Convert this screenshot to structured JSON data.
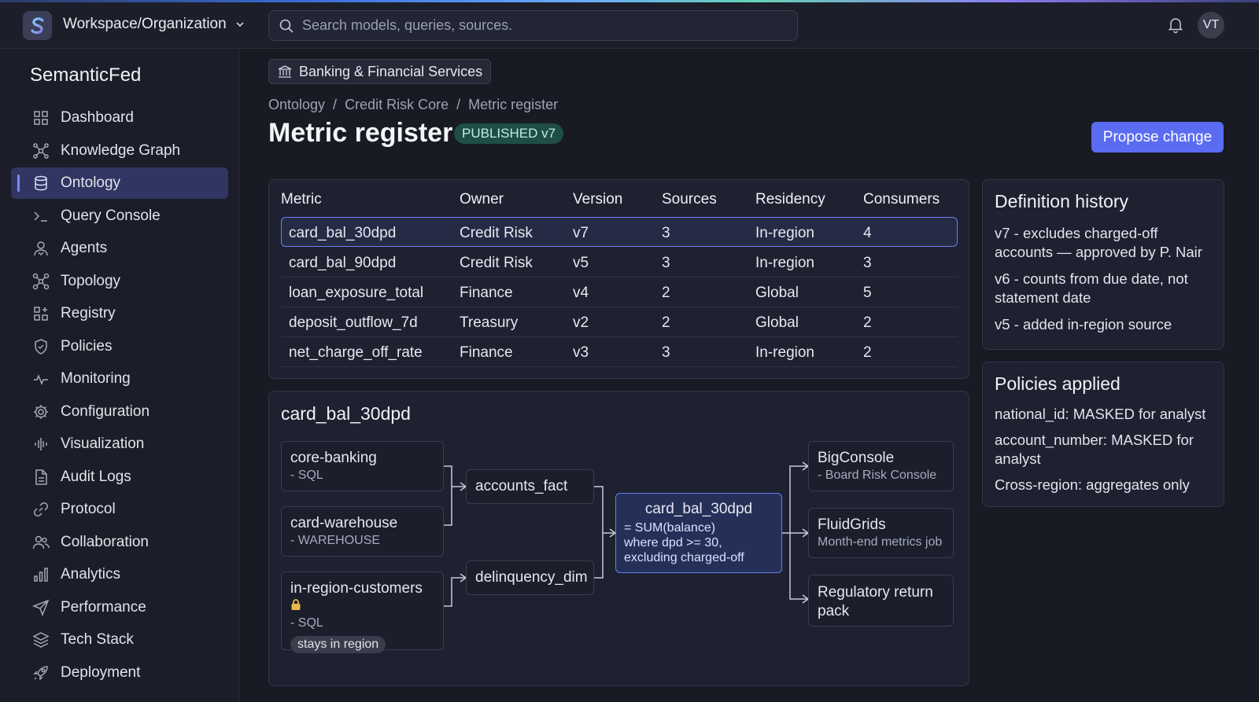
{
  "topbar": {
    "workspace_label": "Workspace/Organization",
    "search_placeholder": "Search models, queries, sources.",
    "avatar_initials": "VT"
  },
  "sidebar": {
    "brand": "SemanticFed",
    "items": [
      {
        "label": "Dashboard",
        "icon": "grid-icon"
      },
      {
        "label": "Knowledge Graph",
        "icon": "graph-icon"
      },
      {
        "label": "Ontology",
        "icon": "database-icon",
        "active": true
      },
      {
        "label": "Query Console",
        "icon": "terminal-icon"
      },
      {
        "label": "Agents",
        "icon": "agents-icon"
      },
      {
        "label": "Topology",
        "icon": "topology-icon"
      },
      {
        "label": "Registry",
        "icon": "registry-icon"
      },
      {
        "label": "Policies",
        "icon": "shield-icon"
      },
      {
        "label": "Monitoring",
        "icon": "pulse-icon"
      },
      {
        "label": "Configuration",
        "icon": "gear-icon"
      },
      {
        "label": "Visualization",
        "icon": "waveform-icon"
      },
      {
        "label": "Audit Logs",
        "icon": "document-icon"
      },
      {
        "label": "Protocol",
        "icon": "link-icon"
      },
      {
        "label": "Collaboration",
        "icon": "users-icon"
      },
      {
        "label": "Analytics",
        "icon": "bar-chart-icon"
      },
      {
        "label": "Performance",
        "icon": "send-icon"
      },
      {
        "label": "Tech Stack",
        "icon": "layers-icon"
      },
      {
        "label": "Deployment",
        "icon": "rocket-icon"
      }
    ]
  },
  "header": {
    "industry_chip": "Banking & Financial Services",
    "breadcrumb": [
      "Ontology",
      "Credit Risk Core",
      "Metric register"
    ],
    "title": "Metric register",
    "status_badge": "PUBLISHED v7",
    "propose_button": "Propose change"
  },
  "table": {
    "columns": [
      "Metric",
      "Owner",
      "Version",
      "Sources",
      "Residency",
      "Consumers"
    ],
    "rows": [
      [
        "card_bal_30dpd",
        "Credit Risk",
        "v7",
        "3",
        "In-region",
        "4"
      ],
      [
        "card_bal_90dpd",
        "Credit Risk",
        "v5",
        "3",
        "In-region",
        "3"
      ],
      [
        "loan_exposure_total",
        "Finance",
        "v4",
        "2",
        "Global",
        "5"
      ],
      [
        "deposit_outflow_7d",
        "Treasury",
        "v2",
        "2",
        "Global",
        "2"
      ],
      [
        "net_charge_off_rate",
        "Finance",
        "v3",
        "3",
        "In-region",
        "2"
      ]
    ],
    "selected_row": 0
  },
  "lineage": {
    "title": "card_bal_30dpd",
    "sources": [
      {
        "name": "core-banking",
        "sub": "- SQL"
      },
      {
        "name": "card-warehouse",
        "sub": "- WAREHOUSE"
      },
      {
        "name": "in-region-customers",
        "sub": "- SQL",
        "tag": "stays in region",
        "icon": "lock-icon"
      }
    ],
    "intermediates": [
      {
        "name": "accounts_fact"
      },
      {
        "name": "delinquency_dim"
      }
    ],
    "metric": {
      "name": "card_bal_30dpd",
      "definition": "= SUM(balance)\nwhere dpd >= 30,\nexcluding charged-off"
    },
    "consumers": [
      {
        "name": "BigConsole",
        "sub": "- Board Risk Console"
      },
      {
        "name": "FluidGrids",
        "sub": "Month-end metrics job"
      },
      {
        "name": "Regulatory return pack",
        "sub": ""
      }
    ]
  },
  "history": {
    "title": "Definition history",
    "entries": [
      "v7 - excludes charged-off accounts — approved by P. Nair",
      "v6 - counts from due date, not statement date",
      "v5 - added in-region source"
    ]
  },
  "policies": {
    "title": "Policies applied",
    "entries": [
      "national_id: MASKED for analyst",
      "account_number: MASKED for analyst",
      "Cross-region: aggregates only"
    ]
  },
  "colors": {
    "accent": "#5a6cf2",
    "active_nav": "#303561",
    "badge_bg": "#1f4d47",
    "lock": "#e6b94a"
  }
}
